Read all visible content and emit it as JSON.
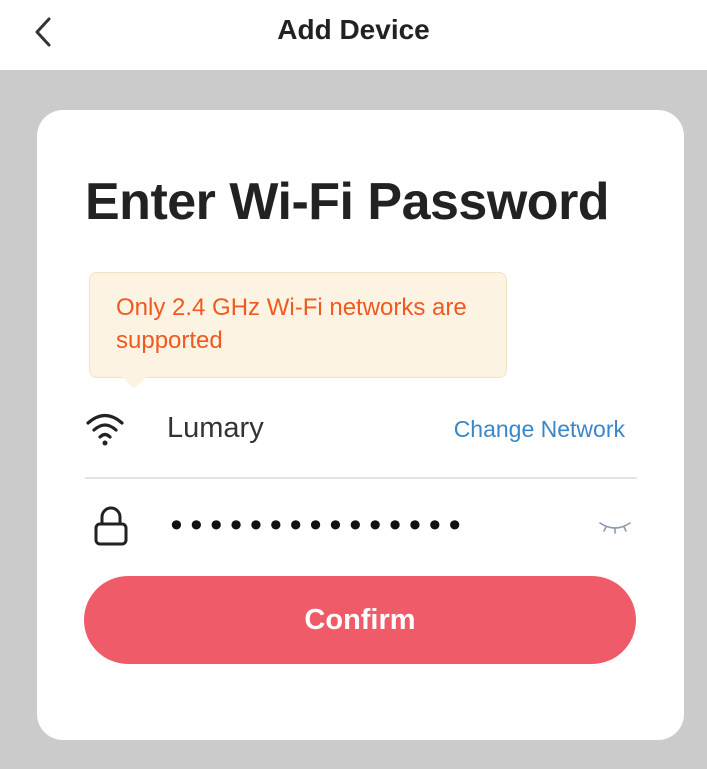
{
  "header": {
    "title": "Add Device",
    "back_icon": "chevron-left-icon"
  },
  "card": {
    "title": "Enter Wi-Fi Password",
    "tooltip": {
      "text": "Only 2.4 GHz Wi-Fi networks are supported"
    },
    "network": {
      "icon": "wifi-icon",
      "name": "Lumary",
      "change_label": "Change Network"
    },
    "password": {
      "icon": "lock-icon",
      "value": "•••••••••••••••",
      "toggle_icon": "eye-closed-icon"
    },
    "confirm_label": "Confirm"
  },
  "colors": {
    "accent": "#ef5b69",
    "link": "#3a86c8",
    "warning_text": "#ee5a1f",
    "warning_bg": "#fdf3e2",
    "overlay": "#cbcbcb"
  }
}
